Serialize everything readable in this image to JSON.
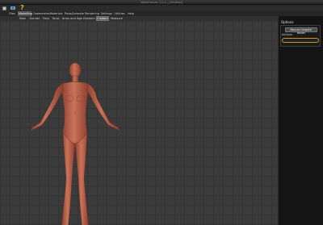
{
  "window": {
    "title": "MakeHuman 1.1.1 - [Untitled]"
  },
  "toolbar": {
    "icons": [
      "save-icon",
      "camera-icon",
      "help-icon"
    ],
    "help_glyph": "?",
    "help_color": "#e8b232"
  },
  "menu": {
    "tabs": [
      {
        "label": "Files"
      },
      {
        "label": "Modelling",
        "active": true
      },
      {
        "label": "Geometries"
      },
      {
        "label": "Materials"
      },
      {
        "label": "Pose/Animate"
      },
      {
        "label": "Rendering"
      },
      {
        "label": "Settings"
      },
      {
        "label": "Utilities"
      },
      {
        "label": "Help"
      }
    ]
  },
  "submenu": {
    "tabs": [
      {
        "label": "Main"
      },
      {
        "label": "Gender"
      },
      {
        "label": "Face"
      },
      {
        "label": "Torso"
      },
      {
        "label": "Arms and legs"
      },
      {
        "label": "Random"
      },
      {
        "label": "Custom",
        "active": true
      },
      {
        "label": "Measure"
      }
    ]
  },
  "panel": {
    "header": "Options",
    "button_label": "Rescan targets' folder",
    "section_label": "Actions",
    "accent_color": "#c8902c"
  },
  "viewport": {
    "model_color": "#c0664a",
    "grid_color": "#3b3b3b"
  }
}
